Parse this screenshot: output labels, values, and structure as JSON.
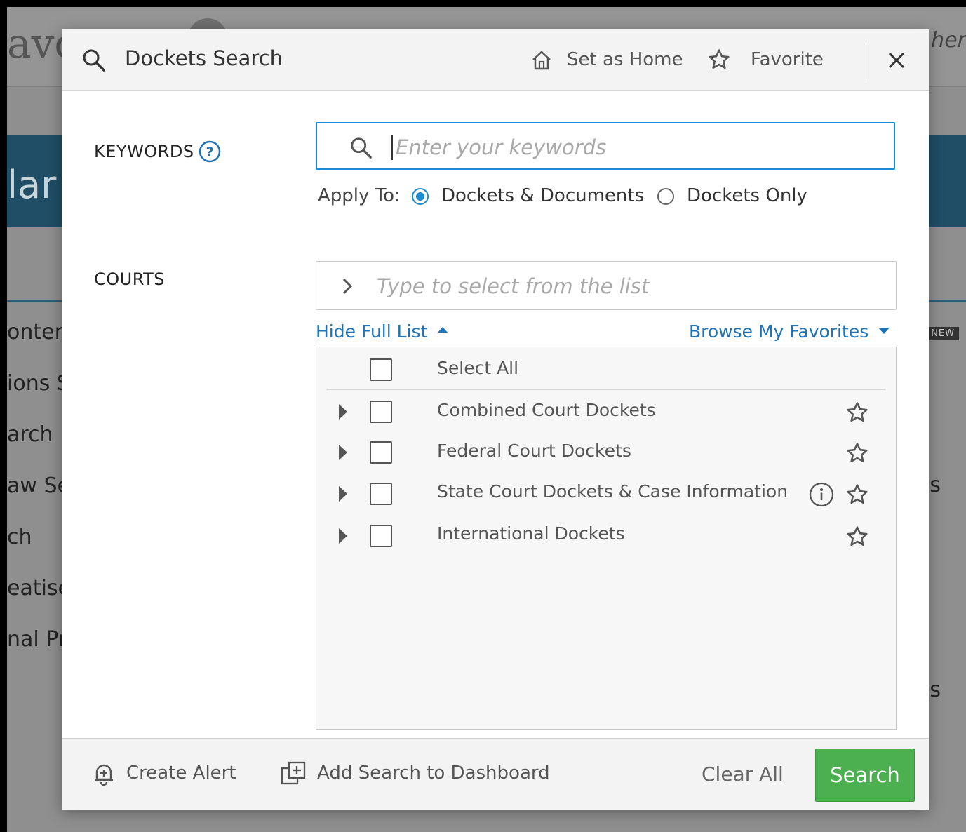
{
  "background": {
    "logo_fragment": "avo",
    "hint_fragment": "s her",
    "band_fragment": "lar",
    "new_badge": "NEW",
    "items": [
      "ontent",
      "ions S",
      "arch",
      "aw Se",
      "ch",
      "eatise",
      "nal Pr"
    ],
    "right_fragments": [
      "s",
      "s"
    ]
  },
  "header": {
    "title": "Dockets Search",
    "set_home_label": "Set as Home",
    "favorite_label": "Favorite"
  },
  "keywords": {
    "label": "KEYWORDS",
    "placeholder": "Enter your keywords",
    "value": ""
  },
  "apply_to": {
    "label": "Apply To:",
    "options": [
      {
        "label": "Dockets & Documents",
        "selected": true
      },
      {
        "label": "Dockets Only",
        "selected": false
      }
    ]
  },
  "courts": {
    "label": "COURTS",
    "placeholder": "Type to select from the list",
    "hide_list_label": "Hide Full List",
    "browse_favorites_label": "Browse My Favorites",
    "select_all_label": "Select All",
    "items": [
      {
        "label": "Combined Court Dockets",
        "checked": false
      },
      {
        "label": "Federal Court Dockets",
        "checked": false
      },
      {
        "label": "State Court Dockets & Case Information",
        "checked": false,
        "has_info": true
      },
      {
        "label": "International Dockets",
        "checked": false
      }
    ]
  },
  "footer": {
    "create_alert_label": "Create Alert",
    "add_dashboard_label": "Add Search to Dashboard",
    "clear_all_label": "Clear All",
    "search_label": "Search"
  },
  "colors": {
    "accent": "#1b8ad1",
    "link": "#1f73b7",
    "search_button": "#4caf50"
  }
}
